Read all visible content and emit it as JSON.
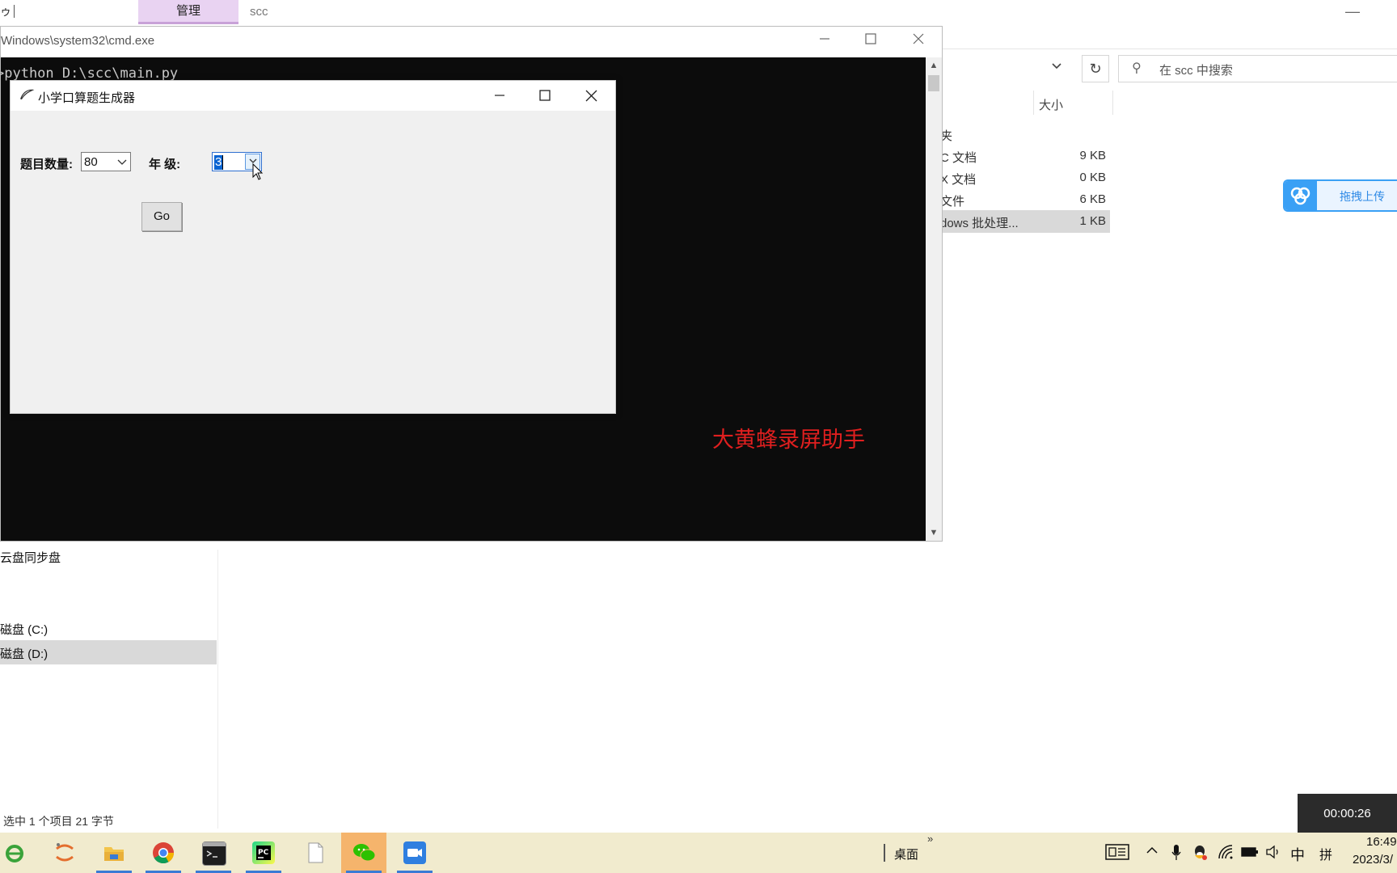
{
  "explorer": {
    "ribbon_tab": "管理",
    "window_title": "scc",
    "quick_access_mark": "ゥ",
    "search_placeholder": "在 scc 中搜索",
    "column_size": "大小",
    "files": [
      {
        "type": "夹",
        "size": ""
      },
      {
        "type": "C 文档",
        "size": "9 KB"
      },
      {
        "type": "X 文档",
        "size": "0 KB"
      },
      {
        "type": "文件",
        "size": "6 KB"
      },
      {
        "type": "dows 批处理...",
        "size": "1 KB"
      }
    ],
    "nav_items": [
      "云盘同步盘",
      "磁盘 (C:)",
      "磁盘 (D:)"
    ],
    "status": "选中 1 个项目  21 字节"
  },
  "baidu": {
    "label": "拖拽上传"
  },
  "timer": "00:00:26",
  "cmd": {
    "title": "Windows\\system32\\cmd.exe",
    "console_text": ">python D:\\scc\\main.py"
  },
  "watermark": "大黄蜂录屏助手",
  "tk": {
    "title": "小学口算题生成器",
    "count_label": "题目数量:",
    "count_value": "80",
    "grade_label": "年  级:",
    "grade_value": "3",
    "go_label": "Go"
  },
  "taskbar": {
    "desktop_label": "桌面",
    "ime_lang": "中",
    "ime_mode": "拼",
    "clock_time": "16:49",
    "clock_date": "2023/3/"
  }
}
